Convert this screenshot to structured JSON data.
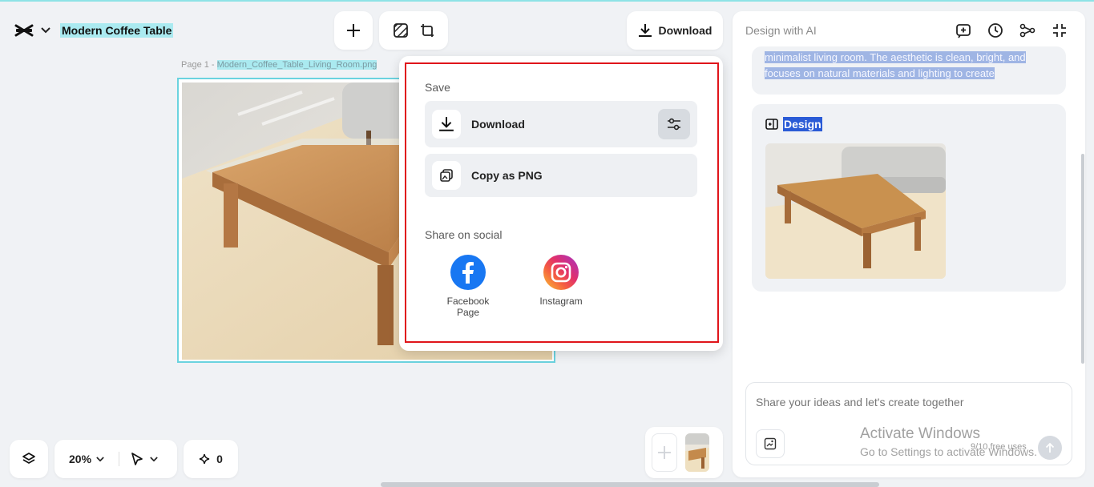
{
  "header": {
    "project_title": "Modern Coffee Table",
    "download_label": "Download"
  },
  "canvas": {
    "page_label": "Page 1 -",
    "file_name": "Modern_Coffee_Table_Living_Room.png"
  },
  "download_popup": {
    "save_heading": "Save",
    "download_label": "Download",
    "copy_png_label": "Copy as PNG",
    "share_heading": "Share on social",
    "social": [
      {
        "label": "Facebook Page",
        "icon": "facebook-icon"
      },
      {
        "label": "Instagram",
        "icon": "instagram-icon"
      }
    ]
  },
  "ai_panel": {
    "title": "Design with AI",
    "prompt_excerpt": "minimalist living room. The aesthetic is clean, bright, and focuses on natural materials and lighting to create",
    "design_label": "Design",
    "input_placeholder": "Share your ideas and let's create together",
    "free_uses": "9/10 free uses"
  },
  "bottom_bar": {
    "zoom": "20%",
    "credits": "0"
  },
  "watermark": {
    "line1": "Activate Windows",
    "line2": "Go to Settings to activate Windows."
  },
  "colors": {
    "accent_highlight": "#aaeaf0",
    "popup_outline": "#e0151b",
    "facebook": "#1877f2",
    "design_highlight": "#2a5bd6"
  }
}
